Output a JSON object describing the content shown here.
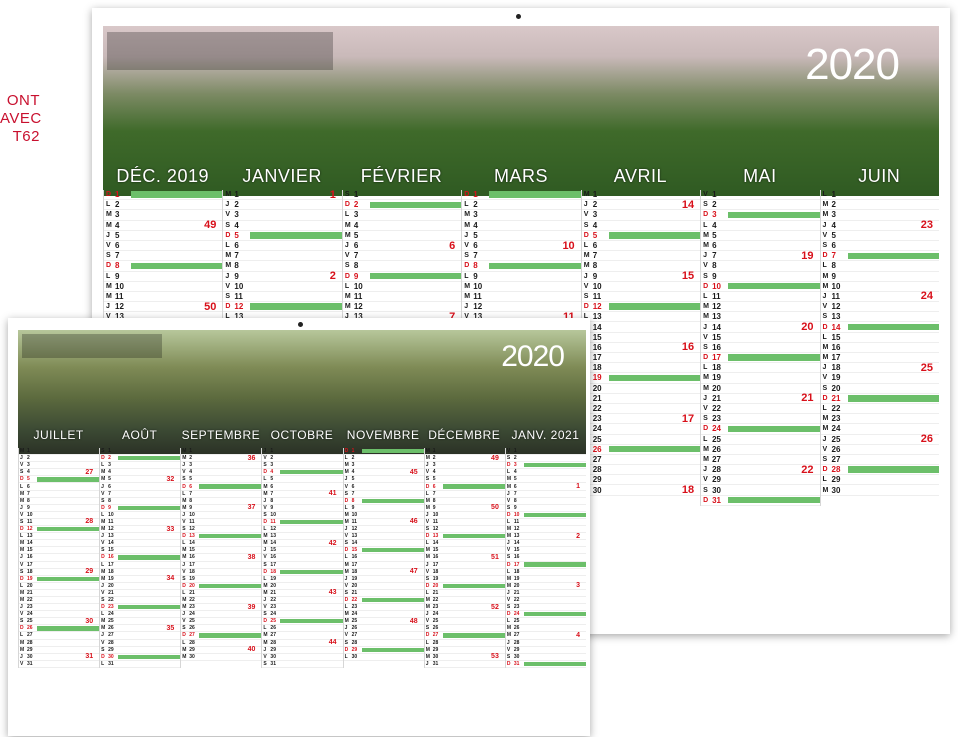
{
  "side_caption": [
    "ONT",
    "AVEC",
    "T62"
  ],
  "back": {
    "year": "2020",
    "months": [
      "DÉC. 2019",
      "JANVIER",
      "FÉVRIER",
      "MARS",
      "AVRIL",
      "MAI",
      "JUIN"
    ],
    "week_numbers": [
      [
        {
          "row": 3,
          "n": "49"
        },
        {
          "row": 11,
          "n": "50"
        }
      ],
      [
        {
          "row": 0,
          "n": "1"
        },
        {
          "row": 8,
          "n": "2"
        }
      ],
      [
        {
          "row": 5,
          "n": "6"
        },
        {
          "row": 12,
          "n": "7"
        }
      ],
      [
        {
          "row": 5,
          "n": "10"
        },
        {
          "row": 12,
          "n": "11"
        }
      ],
      [
        {
          "row": 1,
          "n": "14"
        },
        {
          "row": 8,
          "n": "15"
        },
        {
          "row": 15,
          "n": "16"
        },
        {
          "row": 22,
          "n": "17"
        },
        {
          "row": 29,
          "n": "18"
        }
      ],
      [
        {
          "row": 6,
          "n": "19"
        },
        {
          "row": 13,
          "n": "20"
        },
        {
          "row": 20,
          "n": "21"
        },
        {
          "row": 27,
          "n": "22"
        }
      ],
      [
        {
          "row": 3,
          "n": "23"
        },
        {
          "row": 10,
          "n": "24"
        },
        {
          "row": 17,
          "n": "25"
        },
        {
          "row": 24,
          "n": "26"
        }
      ]
    ],
    "days": [
      {
        "count": 13,
        "letters": [
          "D",
          "L",
          "M",
          "M",
          "J",
          "V",
          "S",
          "D",
          "L",
          "M",
          "M",
          "J",
          "V"
        ],
        "sundays": [
          0,
          7
        ]
      },
      {
        "count": 13,
        "letters": [
          "M",
          "J",
          "V",
          "S",
          "D",
          "L",
          "M",
          "M",
          "J",
          "V",
          "S",
          "D",
          "L"
        ],
        "sundays": [
          4,
          11
        ]
      },
      {
        "count": 13,
        "letters": [
          "S",
          "D",
          "L",
          "M",
          "M",
          "J",
          "V",
          "S",
          "D",
          "L",
          "M",
          "M",
          "J"
        ],
        "sundays": [
          1,
          8
        ]
      },
      {
        "count": 13,
        "letters": [
          "D",
          "L",
          "M",
          "M",
          "J",
          "V",
          "S",
          "D",
          "L",
          "M",
          "M",
          "J",
          "V"
        ],
        "sundays": [
          0,
          7
        ]
      },
      {
        "count": 30,
        "letters": [
          "M",
          "J",
          "V",
          "S",
          "D",
          "L",
          "M",
          "M",
          "J",
          "V",
          "S",
          "D",
          "L",
          "M",
          "M",
          "J",
          "V",
          "S",
          "D",
          "L",
          "M",
          "M",
          "J",
          "V",
          "S",
          "D",
          "L",
          "M",
          "M",
          "J"
        ],
        "sundays": [
          4,
          11,
          18,
          25
        ]
      },
      {
        "count": 31,
        "letters": [
          "V",
          "S",
          "D",
          "L",
          "M",
          "M",
          "J",
          "V",
          "S",
          "D",
          "L",
          "M",
          "M",
          "J",
          "V",
          "S",
          "D",
          "L",
          "M",
          "M",
          "J",
          "V",
          "S",
          "D",
          "L",
          "M",
          "M",
          "J",
          "V",
          "S",
          "D"
        ],
        "sundays": [
          2,
          9,
          16,
          23,
          30
        ]
      },
      {
        "count": 30,
        "letters": [
          "L",
          "M",
          "M",
          "J",
          "V",
          "S",
          "D",
          "L",
          "M",
          "M",
          "J",
          "V",
          "S",
          "D",
          "L",
          "M",
          "M",
          "J",
          "V",
          "S",
          "D",
          "L",
          "M",
          "M",
          "J",
          "V",
          "S",
          "D",
          "L",
          "M"
        ],
        "sundays": [
          6,
          13,
          20,
          27
        ]
      }
    ]
  },
  "front": {
    "year": "2020",
    "months": [
      "JUILLET",
      "AOÛT",
      "SEPTEMBRE",
      "OCTOBRE",
      "NOVEMBRE",
      "DÉCEMBRE",
      "JANV. 2021"
    ],
    "week_numbers": [
      [
        {
          "row": 3,
          "n": "27"
        },
        {
          "row": 10,
          "n": "28"
        },
        {
          "row": 17,
          "n": "29"
        },
        {
          "row": 24,
          "n": "30"
        },
        {
          "row": 29,
          "n": "31"
        }
      ],
      [
        {
          "row": 4,
          "n": "32"
        },
        {
          "row": 11,
          "n": "33"
        },
        {
          "row": 18,
          "n": "34"
        },
        {
          "row": 25,
          "n": "35"
        }
      ],
      [
        {
          "row": 1,
          "n": "36"
        },
        {
          "row": 8,
          "n": "37"
        },
        {
          "row": 15,
          "n": "38"
        },
        {
          "row": 22,
          "n": "39"
        },
        {
          "row": 28,
          "n": "40"
        }
      ],
      [
        {
          "row": 6,
          "n": "41"
        },
        {
          "row": 13,
          "n": "42"
        },
        {
          "row": 20,
          "n": "43"
        },
        {
          "row": 27,
          "n": "44"
        }
      ],
      [
        {
          "row": 3,
          "n": "45"
        },
        {
          "row": 10,
          "n": "46"
        },
        {
          "row": 17,
          "n": "47"
        },
        {
          "row": 24,
          "n": "48"
        }
      ],
      [
        {
          "row": 1,
          "n": "49"
        },
        {
          "row": 8,
          "n": "50"
        },
        {
          "row": 15,
          "n": "51"
        },
        {
          "row": 22,
          "n": "52"
        },
        {
          "row": 29,
          "n": "53"
        }
      ],
      [
        {
          "row": 5,
          "n": "1"
        },
        {
          "row": 12,
          "n": "2"
        },
        {
          "row": 19,
          "n": "3"
        },
        {
          "row": 26,
          "n": "4"
        }
      ]
    ],
    "days": [
      {
        "count": 31,
        "letters": [
          "M",
          "J",
          "V",
          "S",
          "D",
          "L",
          "M",
          "M",
          "J",
          "V",
          "S",
          "D",
          "L",
          "M",
          "M",
          "J",
          "V",
          "S",
          "D",
          "L",
          "M",
          "M",
          "J",
          "V",
          "S",
          "D",
          "L",
          "M",
          "M",
          "J",
          "V"
        ],
        "sundays": [
          4,
          11,
          18,
          25
        ]
      },
      {
        "count": 31,
        "letters": [
          "S",
          "D",
          "L",
          "M",
          "M",
          "J",
          "V",
          "S",
          "D",
          "L",
          "M",
          "M",
          "J",
          "V",
          "S",
          "D",
          "L",
          "M",
          "M",
          "J",
          "V",
          "S",
          "D",
          "L",
          "M",
          "M",
          "J",
          "V",
          "S",
          "D",
          "L"
        ],
        "sundays": [
          1,
          8,
          15,
          22,
          29
        ]
      },
      {
        "count": 30,
        "letters": [
          "M",
          "M",
          "J",
          "V",
          "S",
          "D",
          "L",
          "M",
          "M",
          "J",
          "V",
          "S",
          "D",
          "L",
          "M",
          "M",
          "J",
          "V",
          "S",
          "D",
          "L",
          "M",
          "M",
          "J",
          "V",
          "S",
          "D",
          "L",
          "M",
          "M"
        ],
        "sundays": [
          5,
          12,
          19,
          26
        ]
      },
      {
        "count": 31,
        "letters": [
          "J",
          "V",
          "S",
          "D",
          "L",
          "M",
          "M",
          "J",
          "V",
          "S",
          "D",
          "L",
          "M",
          "M",
          "J",
          "V",
          "S",
          "D",
          "L",
          "M",
          "M",
          "J",
          "V",
          "S",
          "D",
          "L",
          "M",
          "M",
          "J",
          "V",
          "S"
        ],
        "sundays": [
          3,
          10,
          17,
          24
        ]
      },
      {
        "count": 30,
        "letters": [
          "D",
          "L",
          "M",
          "M",
          "J",
          "V",
          "S",
          "D",
          "L",
          "M",
          "M",
          "J",
          "V",
          "S",
          "D",
          "L",
          "M",
          "M",
          "J",
          "V",
          "S",
          "D",
          "L",
          "M",
          "M",
          "J",
          "V",
          "S",
          "D",
          "L"
        ],
        "sundays": [
          0,
          7,
          14,
          21,
          28
        ]
      },
      {
        "count": 31,
        "letters": [
          "M",
          "M",
          "J",
          "V",
          "S",
          "D",
          "L",
          "M",
          "M",
          "J",
          "V",
          "S",
          "D",
          "L",
          "M",
          "M",
          "J",
          "V",
          "S",
          "D",
          "L",
          "M",
          "M",
          "J",
          "V",
          "S",
          "D",
          "L",
          "M",
          "M",
          "J"
        ],
        "sundays": [
          5,
          12,
          19,
          26
        ]
      },
      {
        "count": 31,
        "letters": [
          "V",
          "S",
          "D",
          "L",
          "M",
          "M",
          "J",
          "V",
          "S",
          "D",
          "L",
          "M",
          "M",
          "J",
          "V",
          "S",
          "D",
          "L",
          "M",
          "M",
          "J",
          "V",
          "S",
          "D",
          "L",
          "M",
          "M",
          "J",
          "V",
          "S",
          "D"
        ],
        "sundays": [
          2,
          9,
          16,
          23,
          30
        ]
      }
    ]
  },
  "colors": {
    "sunday_bar": "#6cbf6a",
    "week_number": "#d8101a",
    "caption": "#c8102e"
  }
}
